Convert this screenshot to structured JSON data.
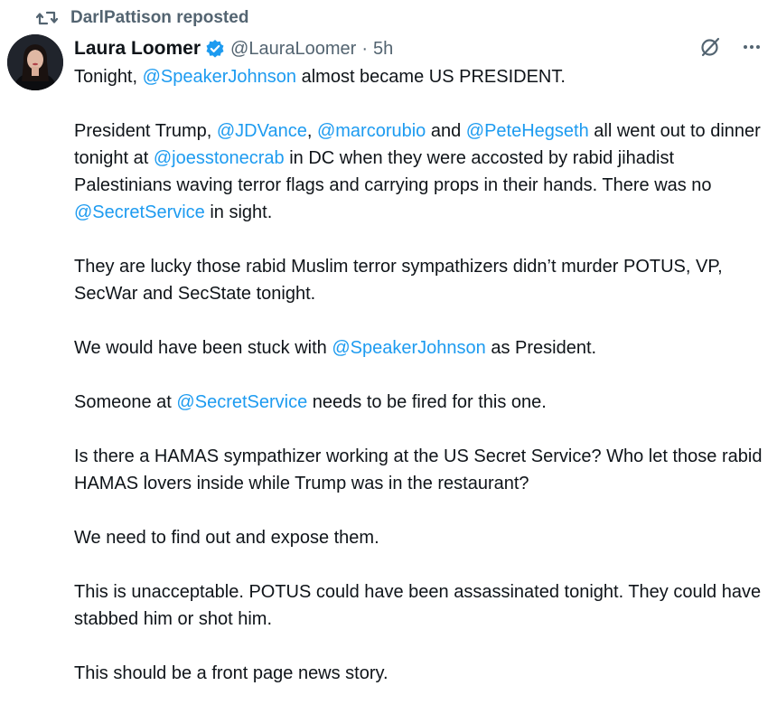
{
  "repost": {
    "text": "DarlPattison reposted"
  },
  "author": {
    "name": "Laura Loomer",
    "handle": "@LauraLoomer",
    "separator": "·",
    "time": "5h"
  },
  "icons": {
    "repost": "repost-icon",
    "verified": "verified-badge-icon",
    "grok": "grok-icon",
    "more": "more-icon"
  },
  "colors": {
    "link": "#1d9bf0",
    "secondary_text": "#536471",
    "verified": "#1d9bf0"
  },
  "tweet": {
    "paragraphs": [
      [
        {
          "t": "Tonight, "
        },
        {
          "t": "@SpeakerJohnson",
          "m": true
        },
        {
          "t": " almost became US PRESIDENT."
        }
      ],
      [
        {
          "t": "President Trump, "
        },
        {
          "t": "@JDVance",
          "m": true
        },
        {
          "t": ", "
        },
        {
          "t": "@marcorubio",
          "m": true
        },
        {
          "t": " and "
        },
        {
          "t": "@PeteHegseth",
          "m": true
        },
        {
          "t": " all went out to dinner tonight at "
        },
        {
          "t": "@joesstonecrab",
          "m": true
        },
        {
          "t": " in DC when they were accosted by rabid jihadist Palestinians waving terror flags and carrying props in their hands. There was no "
        },
        {
          "t": "@SecretService",
          "m": true
        },
        {
          "t": " in sight."
        }
      ],
      [
        {
          "t": "They are lucky those rabid Muslim terror sympathizers didn’t murder POTUS, VP, SecWar and SecState tonight."
        }
      ],
      [
        {
          "t": "We would have been stuck with "
        },
        {
          "t": "@SpeakerJohnson",
          "m": true
        },
        {
          "t": " as President."
        }
      ],
      [
        {
          "t": "Someone at "
        },
        {
          "t": "@SecretService",
          "m": true
        },
        {
          "t": " needs to be fired for this one."
        }
      ],
      [
        {
          "t": "Is there a HAMAS sympathizer working  at the US Secret Service? Who let those rabid HAMAS lovers inside while Trump was in the restaurant?"
        }
      ],
      [
        {
          "t": "We need to find out and expose them."
        }
      ],
      [
        {
          "t": "This is unacceptable. POTUS could have been assassinated tonight. They could have stabbed him or shot him."
        }
      ],
      [
        {
          "t": "This should be a front page news story."
        }
      ]
    ]
  }
}
